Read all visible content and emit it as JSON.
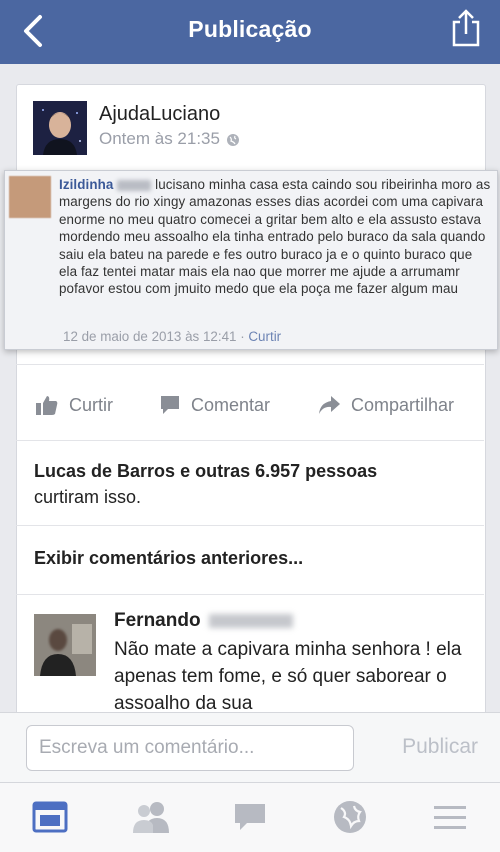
{
  "nav": {
    "title": "Publicação",
    "back_icon": "chevron-left-icon",
    "share_icon": "share-icon"
  },
  "post": {
    "author": "AjudaLuciano",
    "time": "Ontem às 21:35",
    "embedded": {
      "name": "Izildinha",
      "text": "lucisano minha casa esta caindo sou ribeirinha moro as margens do rio xingy amazonas esses dias acordei com uma capivara enorme no meu quatro comecei a gritar bem alto e ela assusto estava mordendo meu assoalho ela tinha entrado pelo buraco da sala quando saiu ela bateu na parede e fes outro buraco ja e o quinto buraco que ela faz tentei matar mais ela nao que morrer me ajude a arrumamr pofavor estou com jmuito medo que ela poça me fazer algum mau",
      "date": "12 de maio de 2013 às 12:41",
      "separator": " · ",
      "like_link": "Curtir"
    }
  },
  "actions": {
    "like": "Curtir",
    "comment": "Comentar",
    "share": "Compartilhar"
  },
  "likes": {
    "name": "Lucas de Barros",
    "connector": " e ",
    "others": "outras 6.957 pessoas",
    "suffix": "curtiram isso."
  },
  "previous_comments": "Exibir comentários anteriores...",
  "comment": {
    "author": "Fernando",
    "text": "Não mate a capivara minha senhora ! ela apenas tem fome, e só quer saborear o assoalho da sua"
  },
  "composer": {
    "placeholder": "Escreva um comentário...",
    "publish": "Publicar"
  },
  "tabbar": {
    "items": [
      "news-feed-icon",
      "friends-icon",
      "messages-icon",
      "globe-icon",
      "menu-icon"
    ],
    "active": "news-feed-icon"
  },
  "colors": {
    "nav": "#4b67a1",
    "link": "#3b5998",
    "active_tab": "#4d6fc2",
    "inactive_tab": "#b7bac2"
  }
}
